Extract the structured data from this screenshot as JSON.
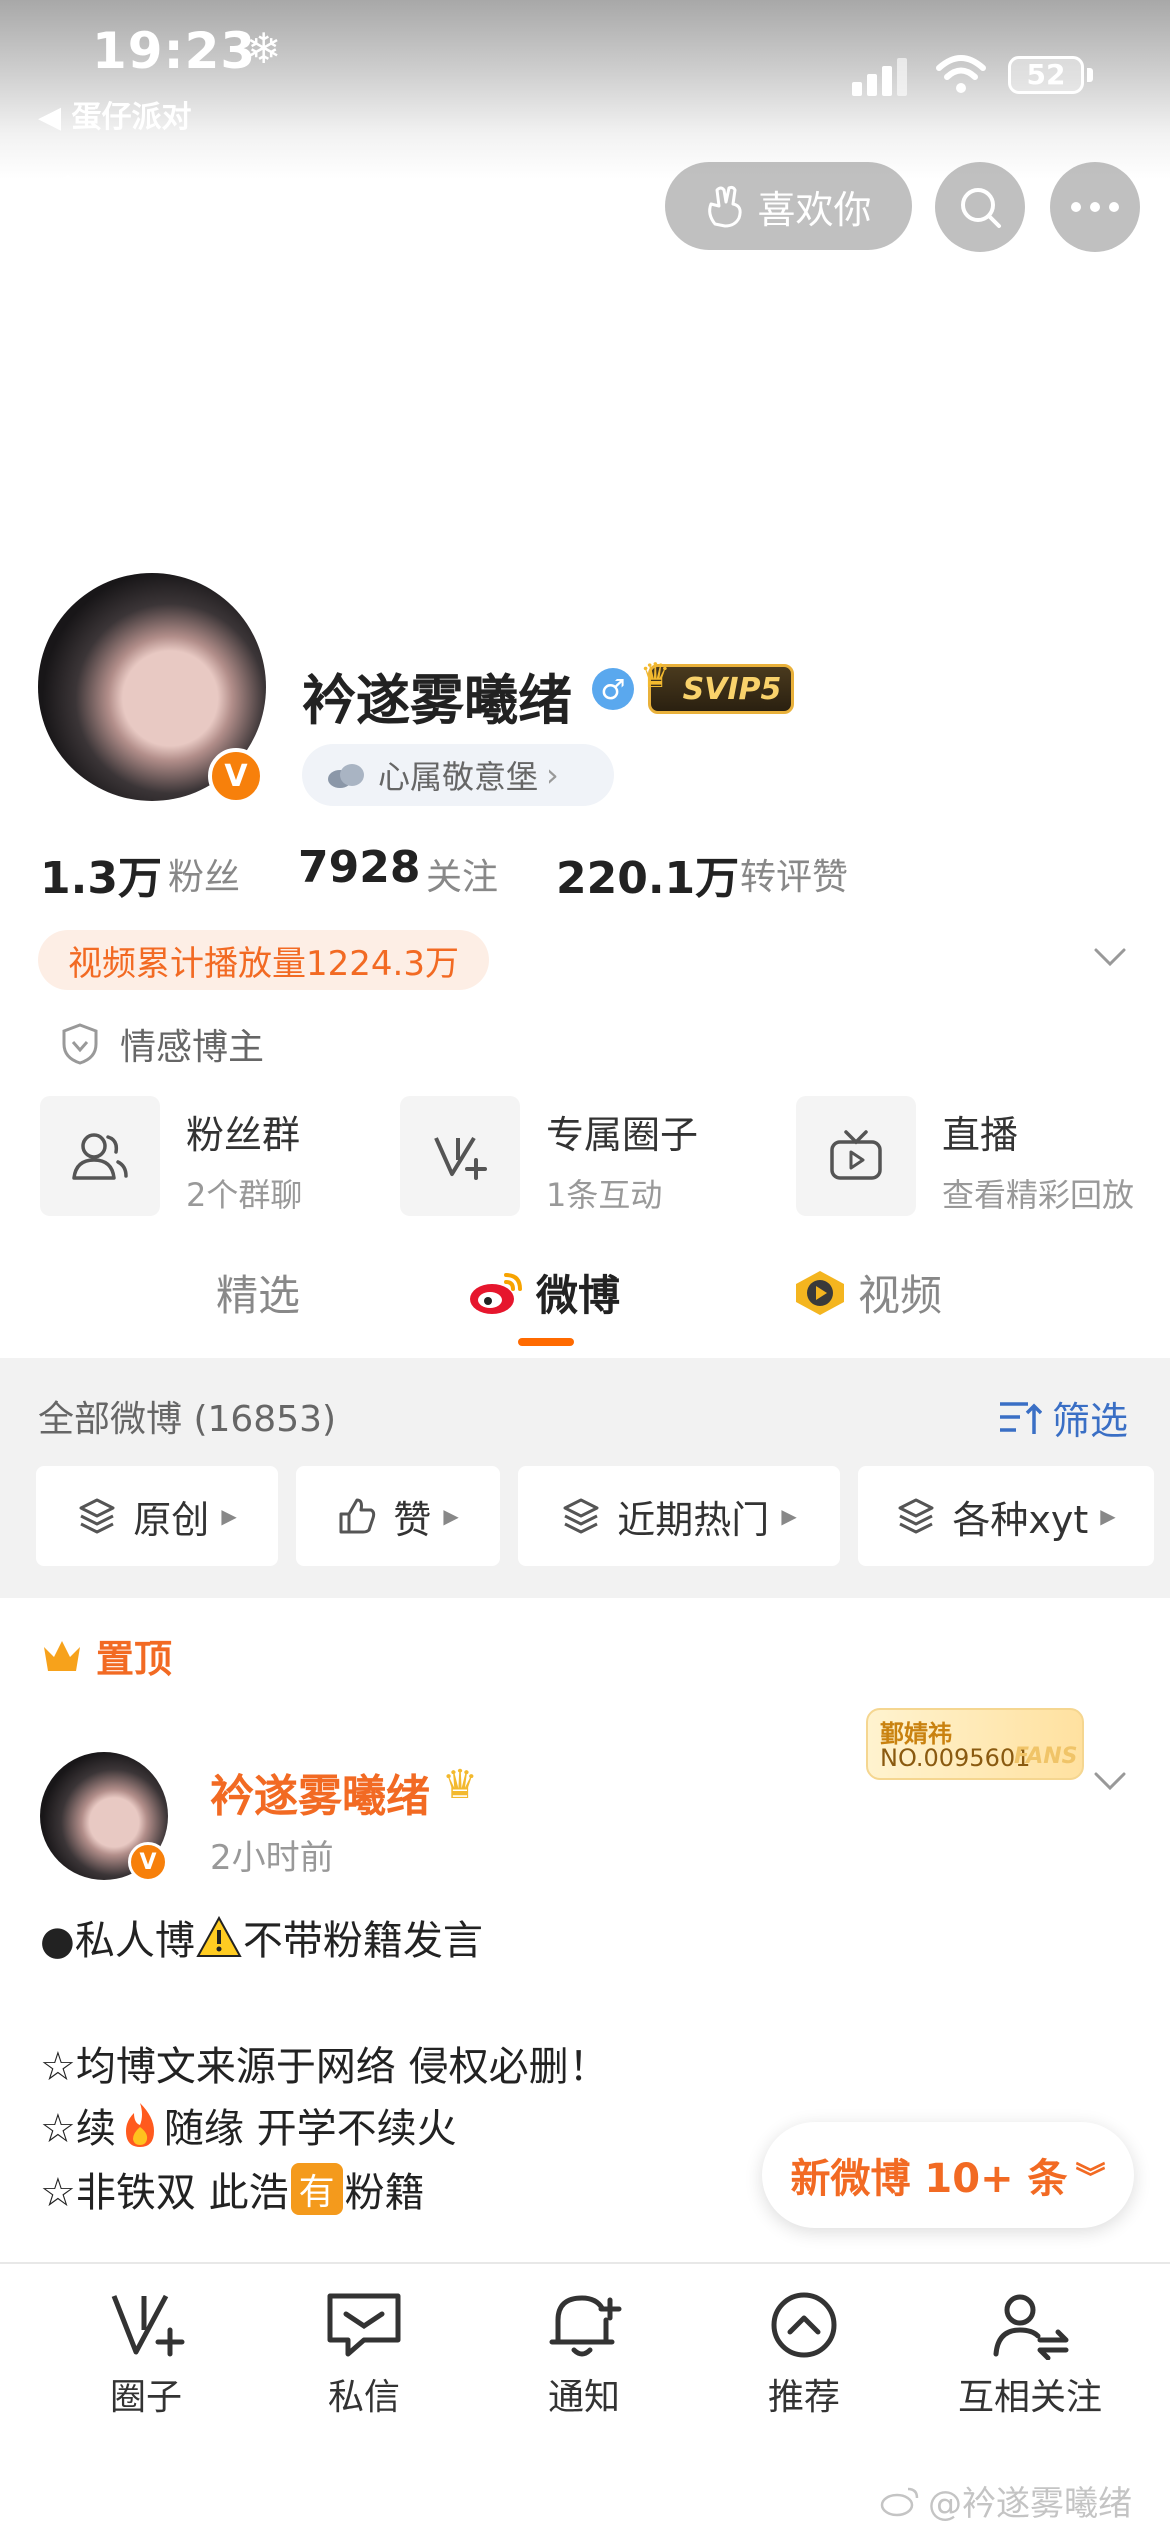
{
  "status_bar": {
    "time": "19:23",
    "weather_icon": "snowflake-icon",
    "back_app": "◀ 蛋仔派对",
    "battery": "52"
  },
  "nav": {
    "like_label": "喜欢你"
  },
  "profile": {
    "name": "衿遂雾曦绪",
    "svip": "SVIP5",
    "group": "心属敬意堡",
    "stats": [
      {
        "value": "1.3万",
        "label": "粉丝"
      },
      {
        "value": "7928",
        "label": "关注"
      },
      {
        "value": "220.1万",
        "label": "转评赞"
      }
    ],
    "play_count": "视频累计播放量1224.3万",
    "tag": "情感博主"
  },
  "features": [
    {
      "title": "粉丝群",
      "sub": "2个群聊",
      "icon": "fans-group-icon"
    },
    {
      "title": "专属圈子",
      "sub": "1条互动",
      "icon": "circle-icon"
    },
    {
      "title": "直播",
      "sub": "查看精彩回放",
      "icon": "live-tv-icon"
    }
  ],
  "tabs": [
    "精选",
    "微博",
    "视频"
  ],
  "feed": {
    "all_label": "全部微博 (16853)",
    "filter_label": "筛选",
    "chips": [
      "原创",
      "赞",
      "近期热门",
      "各种xyt"
    ]
  },
  "pinned": {
    "label": "置顶"
  },
  "post": {
    "author": "衿遂雾曦绪",
    "time": "2小时前",
    "fans_card": {
      "name": "鄞婧祎",
      "number": "NO.0095601",
      "watermark": "FANS"
    },
    "lines": {
      "l1a": "●私人博",
      "l1b": "不带粉籍发言",
      "l2": "☆均博文来源于网络 侵权必删！",
      "l3a": "☆续",
      "l3b": "随缘 开学不续火",
      "l4a": "☆非铁双 此浩",
      "l4box": "有",
      "l4b": "粉籍"
    }
  },
  "new_posts": "新微博 10+ 条",
  "bottom_nav": [
    "圈子",
    "私信",
    "通知",
    "推荐",
    "互相关注"
  ],
  "watermark": "@衿遂雾曦绪",
  "colors": {
    "accent": "#f26a23",
    "link": "#3a6fc5",
    "tab_indicator": "#ff6a00"
  }
}
